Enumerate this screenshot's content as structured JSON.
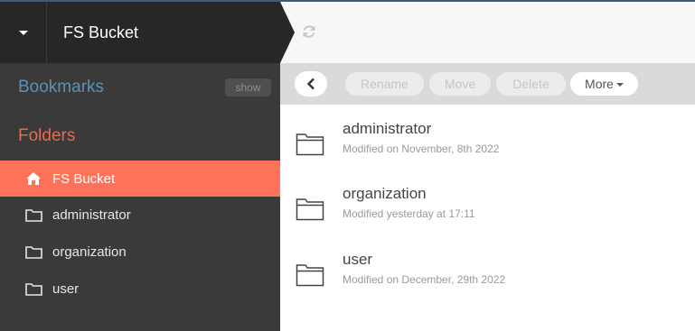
{
  "header": {
    "title": "FS Bucket",
    "menu_icon": "caret-down-icon",
    "refresh_icon": "refresh-icon"
  },
  "sidebar": {
    "bookmarks_label": "Bookmarks",
    "show_label": "show",
    "folders_label": "Folders",
    "items": [
      {
        "label": "FS Bucket",
        "icon": "home-icon",
        "active": true
      },
      {
        "label": "administrator",
        "icon": "folder-icon",
        "active": false
      },
      {
        "label": "organization",
        "icon": "folder-icon",
        "active": false
      },
      {
        "label": "user",
        "icon": "folder-icon",
        "active": false
      }
    ]
  },
  "toolbar": {
    "back_icon": "chevron-left-icon",
    "rename_label": "Rename",
    "move_label": "Move",
    "delete_label": "Delete",
    "more_label": "More"
  },
  "files": [
    {
      "name": "administrator",
      "modified": "Modified on November, 8th 2022"
    },
    {
      "name": "organization",
      "modified": "Modified yesterday at 17:11"
    },
    {
      "name": "user",
      "modified": "Modified on December, 29th 2022"
    }
  ],
  "colors": {
    "header_dark": "#272727",
    "sidebar_bg": "#3a3a3a",
    "active_item": "#fe7259",
    "bookmarks_text": "#5d90b4",
    "folders_text": "#e26b51",
    "toolbar_bg": "#dadada"
  }
}
